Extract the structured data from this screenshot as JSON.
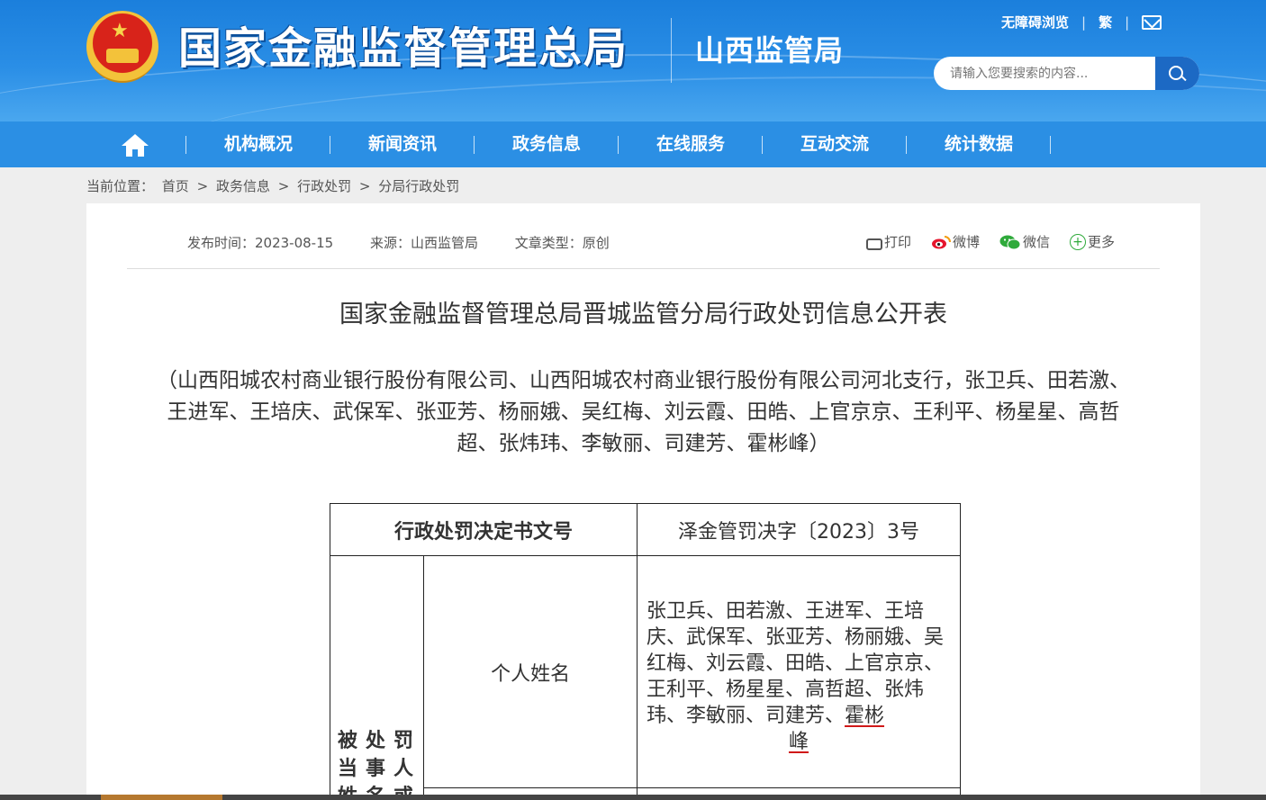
{
  "header": {
    "site_title": "国家金融监督管理总局",
    "sub_title": "山西监管局",
    "accessible_label": "无障碍浏览",
    "traditional_label": "繁",
    "search_placeholder": "请输入您要搜索的内容...",
    "icons": {
      "emblem": "national-emblem-icon",
      "mail": "mail-icon",
      "search": "search-icon"
    }
  },
  "nav": {
    "home_icon": "home-icon",
    "items": [
      "机构概况",
      "新闻资讯",
      "政务信息",
      "在线服务",
      "互动交流",
      "统计数据"
    ]
  },
  "breadcrumb": {
    "prefix": "当前位置：",
    "items": [
      "首页",
      "政务信息",
      "行政处罚",
      "分局行政处罚"
    ],
    "separator": ">"
  },
  "article": {
    "publish_time": "发布时间：2023-08-15",
    "source": "来源：山西监管局",
    "type": "文章类型：原创",
    "share": {
      "print": "打印",
      "weibo": "微博",
      "wechat": "微信",
      "more": "更多"
    },
    "title": "国家金融监督管理总局晋城监管分局行政处罚信息公开表",
    "subtitle": "（山西阳城农村商业银行股份有限公司、山西阳城农村商业银行股份有限公司河北支行，张卫兵、田若激、王进军、王培庆、武保军、张亚芳、杨丽娥、吴红梅、刘云霞、田皓、上官京京、王利平、杨星星、高哲超、张炜玮、李敏丽、司建芳、霍彬峰）"
  },
  "table": {
    "header_label": "行政处罚决定书文号",
    "header_value": "泽金管罚决字〔2023〕3号",
    "group_label_lines": [
      "被处罚",
      "当事人",
      "姓名或"
    ],
    "row_label": "个人姓名",
    "names_main": "张卫兵、田若激、王进军、王培庆、武保军、张亚芳、杨丽娥、吴红梅、刘云霞、田皓、上官京京、王利平、杨星星、高哲超、张炜玮、李敏丽、司建芳、",
    "names_tail_1": "霍彬",
    "names_tail_2": "峰"
  },
  "colors": {
    "header_blue": "#1b7fdc",
    "nav_blue": "#2b8fe4",
    "search_button": "#1c69c4",
    "underline_red": "#d01818"
  }
}
